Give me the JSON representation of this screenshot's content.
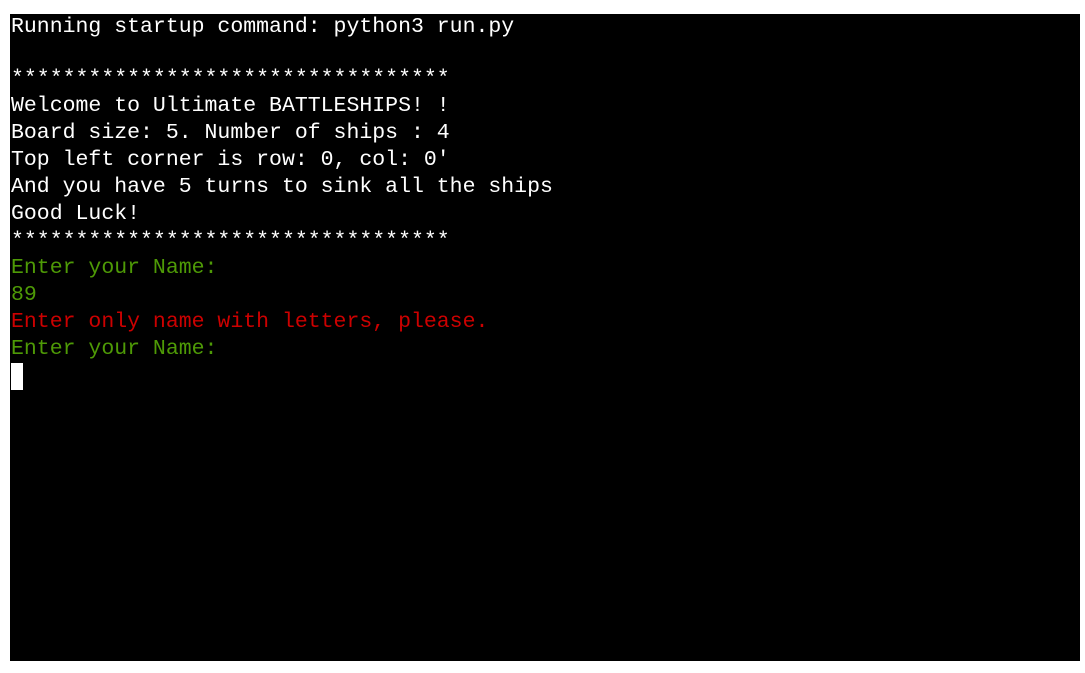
{
  "terminal": {
    "startup": "Running startup command: python3 run.py",
    "border_top": "**********************************",
    "welcome": "Welcome to Ultimate BATTLESHIPS! !",
    "board_info": "Board size: 5. Number of ships : 4",
    "corner_info": "Top left corner is row: 0, col: 0'",
    "turns_info": "And you have 5 turns to sink all the ships",
    "good_luck": "Good Luck!",
    "border_bottom": "**********************************",
    "prompt_1": "Enter your Name:",
    "input_1": "89",
    "error_1": "Enter only name with letters, please.",
    "prompt_2": "Enter your Name:"
  },
  "colors": {
    "background": "#000000",
    "text": "#ffffff",
    "prompt": "#4e9a06",
    "error": "#cc0000"
  }
}
